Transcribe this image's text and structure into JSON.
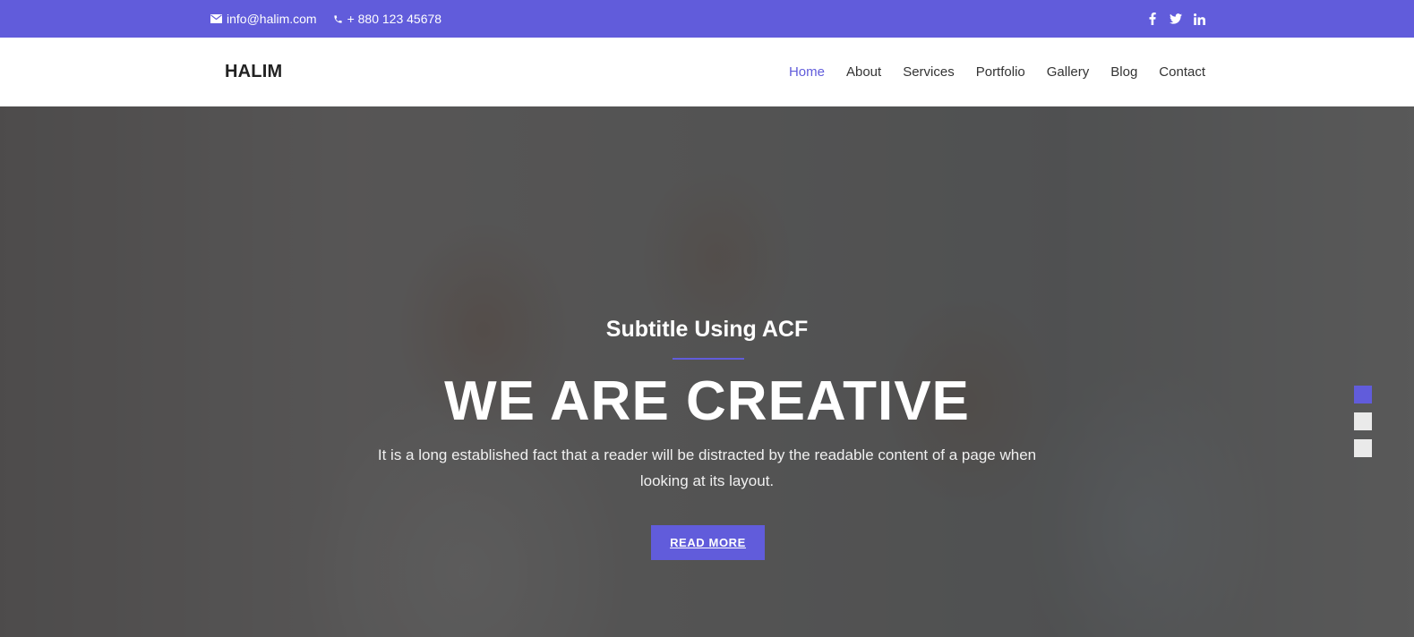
{
  "topbar": {
    "email": "info@halim.com",
    "phone": "+ 880 123 45678",
    "email_icon": "envelope-icon",
    "phone_icon": "phone-icon",
    "social": [
      {
        "icon": "facebook-icon",
        "glyph": "f"
      },
      {
        "icon": "twitter-icon",
        "glyph": "t"
      },
      {
        "icon": "linkedin-icon",
        "glyph": "in"
      }
    ]
  },
  "navbar": {
    "logo": "HALIM",
    "items": [
      {
        "label": "Home",
        "active": true
      },
      {
        "label": "About",
        "active": false
      },
      {
        "label": "Services",
        "active": false
      },
      {
        "label": "Portfolio",
        "active": false
      },
      {
        "label": "Gallery",
        "active": false
      },
      {
        "label": "Blog",
        "active": false
      },
      {
        "label": "Contact",
        "active": false
      }
    ]
  },
  "hero": {
    "subtitle": "Subtitle Using ACF",
    "title": "WE ARE CREATIVE",
    "text": "It is a long established fact that a reader will be distracted by the readable content of a page when looking at its layout.",
    "button_label": "READ MORE"
  },
  "slider": {
    "count": 3,
    "active_index": 0
  },
  "colors": {
    "accent": "#615cdb",
    "text_dark": "#333333"
  }
}
